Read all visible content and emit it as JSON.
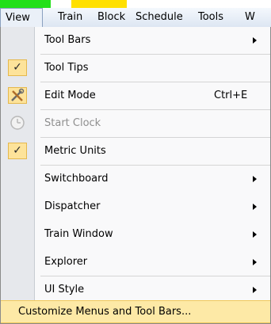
{
  "menubar": {
    "items": [
      {
        "label": "View"
      },
      {
        "label": "Train"
      },
      {
        "label": "Block"
      },
      {
        "label": "Schedule"
      },
      {
        "label": "Tools"
      },
      {
        "label": "W"
      }
    ]
  },
  "view_menu": {
    "items": [
      {
        "label": "Tool Bars",
        "submenu": true
      },
      {
        "label": "Tool Tips",
        "checked": true,
        "icon": "check-icon"
      },
      {
        "label": "Edit Mode",
        "shortcut": "Ctrl+E",
        "icon": "tools-icon"
      },
      {
        "label": "Start Clock",
        "disabled": true,
        "icon": "clock-icon"
      },
      {
        "label": "Metric Units",
        "checked": true,
        "icon": "check-icon"
      },
      {
        "label": "Switchboard",
        "submenu": true
      },
      {
        "label": "Dispatcher",
        "submenu": true
      },
      {
        "label": "Train Window",
        "submenu": true
      },
      {
        "label": "Explorer",
        "submenu": true
      },
      {
        "label": "UI Style",
        "submenu": true
      },
      {
        "label": "Customize Menus and Tool Bars...",
        "highlighted": true
      }
    ]
  },
  "colors": {
    "highlight": "#fde9a6",
    "check_bg": "#fde39a",
    "gutter": "#e6e8ec"
  }
}
